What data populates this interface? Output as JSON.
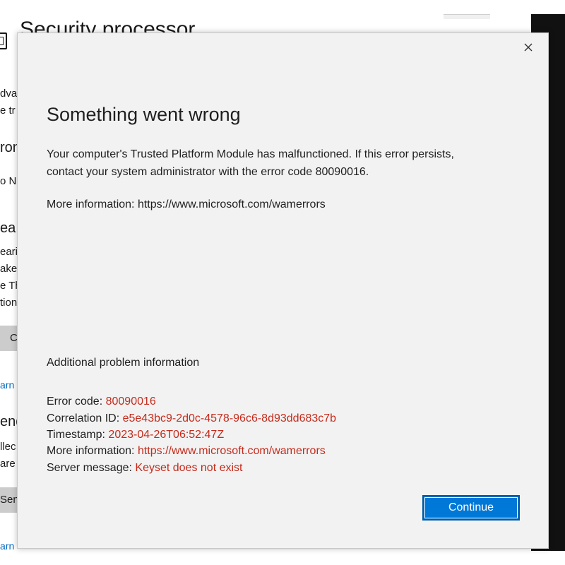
{
  "background": {
    "title": "Security processor",
    "fragments": [
      "dvar",
      "e tr",
      "ron",
      "o No",
      "ea",
      "eari",
      "ake",
      "e Th",
      "tion",
      "arn",
      "end",
      "llec",
      "are",
      "arn"
    ],
    "buttons": [
      "C",
      "Sen"
    ]
  },
  "dialog": {
    "close_glyph": "×",
    "title": "Something went wrong",
    "message_line1": "Your computer's Trusted Platform Module has malfunctioned. If this error persists,",
    "message_line2": "contact your system administrator with the error code 80090016.",
    "more_info": "More information: https://www.microsoft.com/wamerrors",
    "additional_heading": "Additional problem information",
    "details": [
      {
        "label": "Error code: ",
        "value": "80090016"
      },
      {
        "label": "Correlation ID: ",
        "value": "e5e43bc9-2d0c-4578-96c6-8d93dd683c7b"
      },
      {
        "label": "Timestamp: ",
        "value": "2023-04-26T06:52:47Z"
      },
      {
        "label": "More information: ",
        "value": "https://www.microsoft.com/wamerrors"
      },
      {
        "label": "Server message: ",
        "value": "Keyset does not exist"
      }
    ],
    "continue_label": "Continue"
  },
  "colors": {
    "accent": "#0078d7",
    "error_value": "#c42b1c",
    "dialog_bg": "#f2f2f2"
  }
}
